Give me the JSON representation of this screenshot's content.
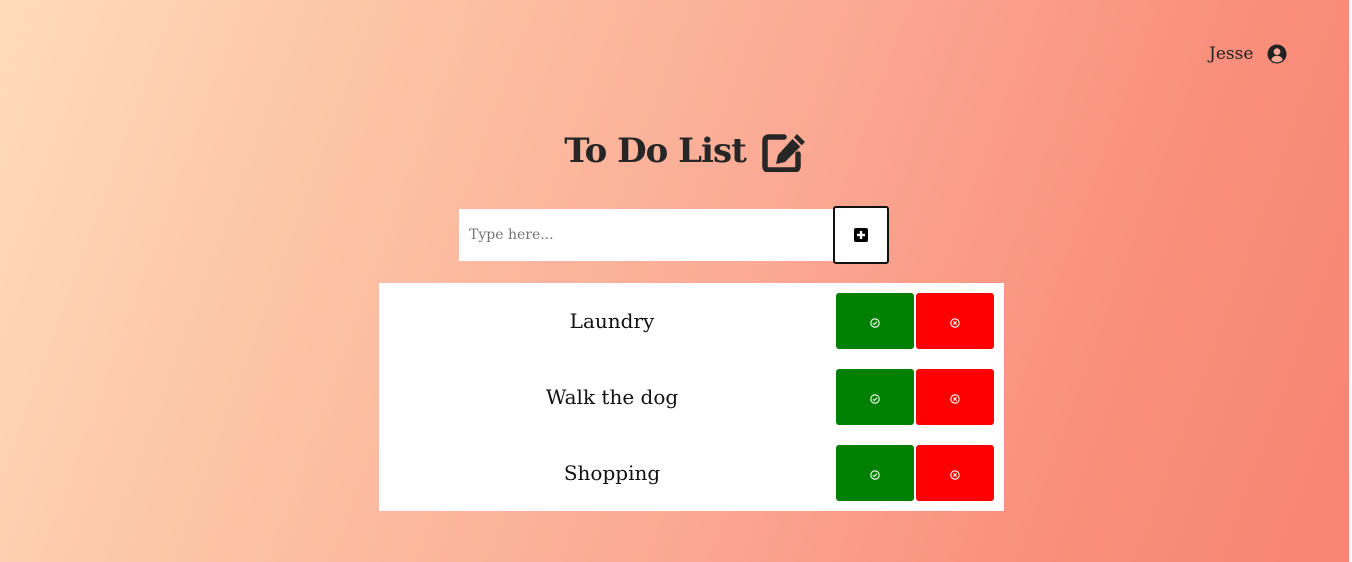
{
  "header": {
    "user_name": "Jesse",
    "user_icon": "user-circle-icon"
  },
  "main": {
    "title": "To Do List",
    "title_icon": "edit-icon",
    "input": {
      "placeholder": "Type here...",
      "value": ""
    },
    "add_icon": "plus-square-icon",
    "items": [
      {
        "label": "Laundry"
      },
      {
        "label": "Walk the dog"
      },
      {
        "label": "Shopping"
      }
    ],
    "done_icon": "check-circle-icon",
    "delete_icon": "x-circle-icon"
  },
  "colors": {
    "gradient_start": "#ffdbbb",
    "gradient_end": "#f88473",
    "done_button": "#008000",
    "delete_button": "#ff0000"
  }
}
